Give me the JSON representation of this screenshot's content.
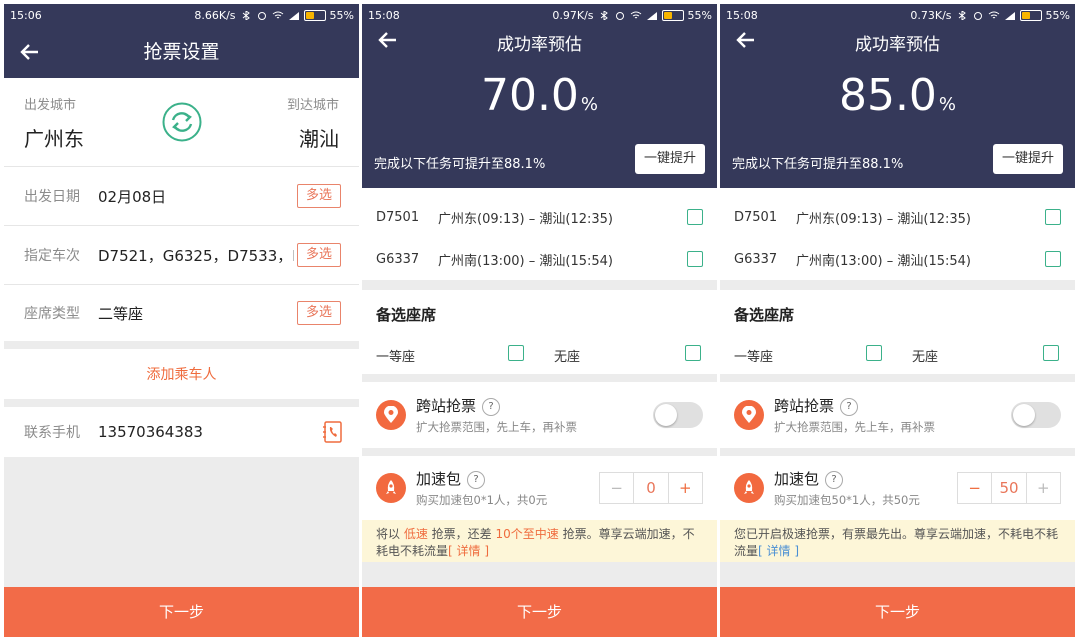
{
  "screens": [
    {
      "status": {
        "time": "15:06",
        "speed": "8.66K/s",
        "battery": "55%",
        "battery_fraction": 0.55
      },
      "title": "抢票设置",
      "from_label": "出发城市",
      "from_city": "广州东",
      "to_label": "到达城市",
      "to_city": "潮汕",
      "date_label": "出发日期",
      "date_value": "02月08日",
      "date_btn": "多选",
      "train_label": "指定车次",
      "train_value": "D7521，G6325，D7533，D...",
      "train_btn": "多选",
      "seat_label": "座席类型",
      "seat_value": "二等座",
      "seat_btn": "多选",
      "add_passenger": "添加乘车人",
      "phone_label": "联系手机",
      "phone_value": "13570364383",
      "next": "下一步",
      "icons": {
        "back": "back-arrow-icon",
        "swap": "swap-refresh-icon",
        "contact": "contact-book-icon"
      },
      "colors": {
        "accent": "#f26b48",
        "swap": "#3bb18a",
        "header": "#35395a"
      }
    },
    {
      "status": {
        "time": "15:08",
        "speed": "0.97K/s",
        "battery": "55%",
        "battery_fraction": 0.55
      },
      "title": "成功率预估",
      "rate": "70.0",
      "rate_unit": "%",
      "task_text": "完成以下任务可提升至88.1%",
      "boost_btn": "一键提升",
      "trains": [
        {
          "no": "D7501",
          "route": "广州东(09:13) – 潮汕(12:35)"
        },
        {
          "no": "G6337",
          "route": "广州南(13:00) – 潮汕(15:54)"
        }
      ],
      "alt_seat_title": "备选座席",
      "alt_seats": [
        "一等座",
        "无座"
      ],
      "cross_title": "跨站抢票",
      "cross_q": "?",
      "cross_sub": "扩大抢票范围，先上车，再补票",
      "speed_title": "加速包",
      "speed_q": "?",
      "speed_sub": "购买加速包0*1人，共0元",
      "stepper": {
        "minus": "−",
        "value": "0",
        "plus": "+"
      },
      "notice": {
        "a": "将以",
        "b": " 低速 ",
        "c": "抢票，还差 ",
        "d": "10个至中速",
        "e": " 抢票。尊享云端加速，不耗电不耗流量",
        "link": "[ 详情 ]"
      },
      "next": "下一步"
    },
    {
      "status": {
        "time": "15:08",
        "speed": "0.73K/s",
        "battery": "55%",
        "battery_fraction": 0.55
      },
      "title": "成功率预估",
      "rate": "85.0",
      "rate_unit": "%",
      "task_text": "完成以下任务可提升至88.1%",
      "boost_btn": "一键提升",
      "trains": [
        {
          "no": "D7501",
          "route": "广州东(09:13) – 潮汕(12:35)"
        },
        {
          "no": "G6337",
          "route": "广州南(13:00) – 潮汕(15:54)"
        }
      ],
      "alt_seat_title": "备选座席",
      "alt_seats": [
        "一等座",
        "无座"
      ],
      "cross_title": "跨站抢票",
      "cross_q": "?",
      "cross_sub": "扩大抢票范围，先上车，再补票",
      "speed_title": "加速包",
      "speed_q": "?",
      "speed_sub": "购买加速包50*1人，共50元",
      "stepper": {
        "minus": "−",
        "value": "50",
        "plus": "+"
      },
      "notice": {
        "a": "您已开启极速抢票，有票最先出。尊享云端加速，不耗电不耗流量",
        "link": "[ 详情 ]"
      },
      "next": "下一步"
    }
  ]
}
